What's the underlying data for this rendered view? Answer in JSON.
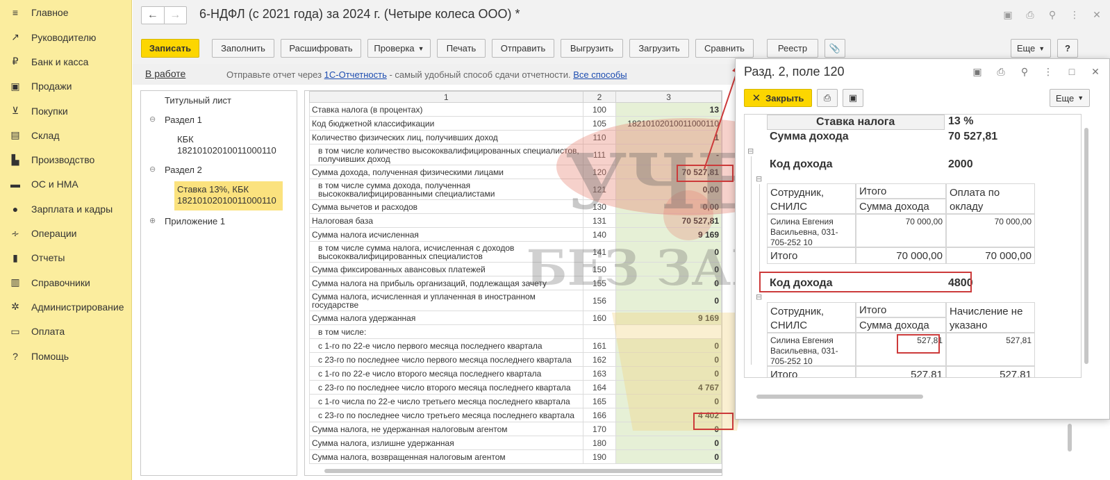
{
  "sidebar": {
    "items": [
      {
        "label": "Главное",
        "icon": "menu-icon"
      },
      {
        "label": "Руководителю",
        "icon": "trend-icon"
      },
      {
        "label": "Банк и касса",
        "icon": "ruble-icon"
      },
      {
        "label": "Продажи",
        "icon": "bag-icon"
      },
      {
        "label": "Покупки",
        "icon": "cart-icon"
      },
      {
        "label": "Склад",
        "icon": "warehouse-icon"
      },
      {
        "label": "Производство",
        "icon": "factory-icon"
      },
      {
        "label": "ОС и НМА",
        "icon": "truck-icon"
      },
      {
        "label": "Зарплата и кадры",
        "icon": "person-icon"
      },
      {
        "label": "Операции",
        "icon": "dt-kt-icon"
      },
      {
        "label": "Отчеты",
        "icon": "bar-chart-icon"
      },
      {
        "label": "Справочники",
        "icon": "books-icon"
      },
      {
        "label": "Администрирование",
        "icon": "gear-icon"
      },
      {
        "label": "Оплата",
        "icon": "payment-icon"
      },
      {
        "label": "Помощь",
        "icon": "question-icon"
      }
    ]
  },
  "window": {
    "title": "6-НДФЛ (с 2021 года) за 2024 г. (Четыре колеса ООО) *"
  },
  "toolbar": {
    "save": "Записать",
    "fill": "Заполнить",
    "decode": "Расшифровать",
    "check": "Проверка",
    "print": "Печать",
    "send": "Отправить",
    "unload": "Выгрузить",
    "load": "Загрузить",
    "compare": "Сравнить",
    "registry": "Реестр",
    "more": "Еще",
    "help": "?"
  },
  "infobar": {
    "status": "В работе",
    "msg_pre": "Отправьте отчет через ",
    "link1": "1С-Отчетность",
    "msg_mid": " - самый удобный способ сдачи отчетности. ",
    "link2": "Все способы"
  },
  "tree": {
    "title": "Титульный лист",
    "section1": "Раздел 1",
    "kbk_label": "КБК",
    "kbk_code": "18210102010011000110",
    "section2": "Раздел 2",
    "rate_label": "Ставка 13%, КБК",
    "rate_code": "18210102010011000110",
    "appendix": "Приложение 1"
  },
  "grid": {
    "headers": [
      "1",
      "2",
      "3"
    ],
    "rows": [
      {
        "name": "Ставка налога (в процентах)",
        "code": "100",
        "value": "13"
      },
      {
        "name": "Код бюджетной классификации",
        "code": "105",
        "value": "18210102010011000110"
      },
      {
        "name": "Количество физических лиц, получивших доход",
        "code": "110",
        "value": "1"
      },
      {
        "name": "в том числе количество высококвалифицированных специалистов, получивших доход",
        "code": "111",
        "value": "-"
      },
      {
        "name": "Сумма дохода, полученная физическими лицами",
        "code": "120",
        "value": "70 527,81"
      },
      {
        "name": "в том числе сумма дохода, полученная высококвалифицированными специалистами",
        "code": "121",
        "value": "0,00"
      },
      {
        "name": "Сумма вычетов и расходов",
        "code": "130",
        "value": "0,00"
      },
      {
        "name": "Налоговая база",
        "code": "131",
        "value": "70 527,81"
      },
      {
        "name": "Сумма налога исчисленная",
        "code": "140",
        "value": "9 169"
      },
      {
        "name": "в том числе сумма налога, исчисленная с доходов высококвалифицированных специалистов",
        "code": "141",
        "value": "0"
      },
      {
        "name": "Сумма фиксированных авансовых платежей",
        "code": "150",
        "value": "0"
      },
      {
        "name": "Сумма налога на прибыль организаций, подлежащая зачету",
        "code": "155",
        "value": "0"
      },
      {
        "name": "Сумма налога, исчисленная и уплаченная в иностранном государстве",
        "code": "156",
        "value": "0"
      },
      {
        "name": "Сумма налога удержанная",
        "code": "160",
        "value": "9 169"
      },
      {
        "name": "в том числе:",
        "code": "",
        "value": ""
      },
      {
        "name": "с 1-го по 22-е число первого месяца последнего квартала",
        "code": "161",
        "value": "0"
      },
      {
        "name": "с 23-го по последнее число первого месяца последнего квартала",
        "code": "162",
        "value": "0"
      },
      {
        "name": "с 1-го по 22-е число второго месяца последнего квартала",
        "code": "163",
        "value": "0"
      },
      {
        "name": "с 23-го по последнее число второго месяца последнего квартала",
        "code": "164",
        "value": "4 767"
      },
      {
        "name": "с 1-го числа по 22-е число третьего месяца последнего квартала",
        "code": "165",
        "value": "0"
      },
      {
        "name": "с 23-го по последнее число третьего месяца последнего квартала",
        "code": "166",
        "value": "4 402"
      },
      {
        "name": "Сумма налога, не удержанная налоговым агентом",
        "code": "170",
        "value": "0"
      },
      {
        "name": "Сумма налога, излишне удержанная",
        "code": "180",
        "value": "0"
      },
      {
        "name": "Сумма налога, возвращенная налоговым агентом",
        "code": "190",
        "value": "0"
      }
    ]
  },
  "popup": {
    "title": "Разд. 2, поле 120",
    "close": "Закрыть",
    "more": "Еще",
    "rate_label": "Ставка налога",
    "rate_value": "13 %",
    "income_label": "Сумма дохода",
    "income_value": "70 527,81",
    "code_label": "Код дохода",
    "code1": "2000",
    "code2": "4800",
    "col_employee": "Сотрудник, СНИЛС",
    "col_total": "Итого",
    "col_income": "Сумма дохода",
    "col_salary": "Оплата по окладу",
    "col_unspecified": "Начисление не указано",
    "employee": "Силина Евгения Васильевна, 031-705-252 10",
    "g1_total": "70 000,00",
    "g1_salary": "70 000,00",
    "g2_total": "527,81",
    "g2_other": "527,81",
    "total_label": "Итого"
  },
  "watermark": {
    "line1": "УЧЕТ",
    "line2": "БЕЗ ЗАБОТ"
  },
  "colors": {
    "accent": "#fcd600",
    "sidebar": "#fbed9e",
    "highlight": "#cc3a3a"
  }
}
